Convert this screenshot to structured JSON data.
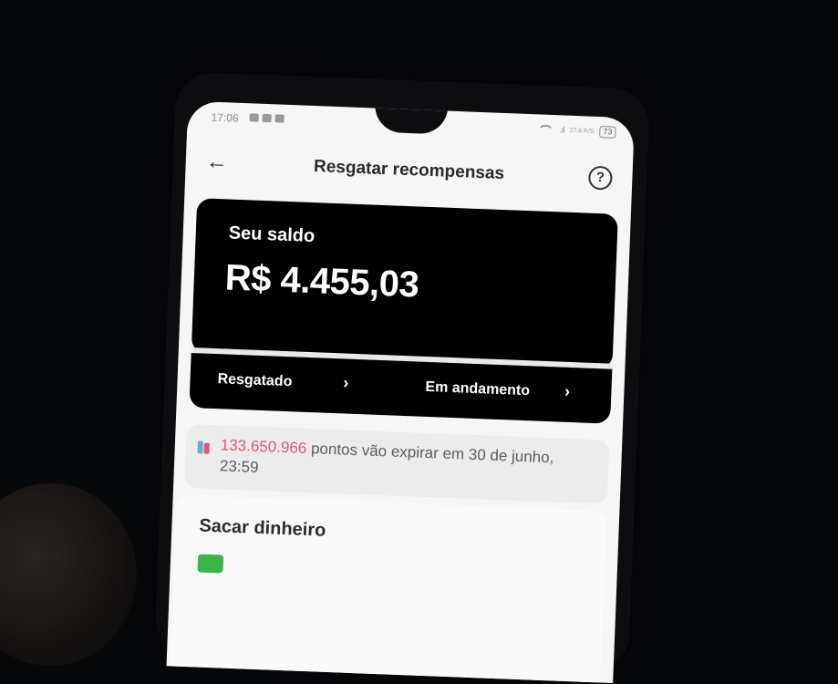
{
  "status_bar": {
    "time": "17:06",
    "speed": "27,6 K/S",
    "battery": "73"
  },
  "header": {
    "title": "Resgatar recompensas",
    "back_icon": "arrow-left-icon",
    "help_icon": "question-circle-icon",
    "help_glyph": "?"
  },
  "balance": {
    "label": "Seu saldo",
    "value": "R$ 4.455,03"
  },
  "links": [
    {
      "label": "Resgatado",
      "chevron": "›"
    },
    {
      "label": "Em andamento",
      "chevron": "›"
    }
  ],
  "expire_notice": {
    "points": "133.650.966",
    "text": " pontos vão expirar em 30 de junho, 23:59",
    "points_color": "#e0566a"
  },
  "withdraw": {
    "title": "Sacar dinheiro"
  }
}
